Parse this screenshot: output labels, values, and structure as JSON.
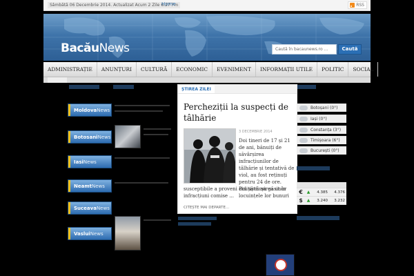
{
  "topbar": {
    "date": "Sâmbătă 06 Decembrie 2014. Actualizat Acum 2 Zile 6:27 Pm",
    "home": "Home",
    "rss": "RSS"
  },
  "header": {
    "logo_bold": "Bacău",
    "logo_light": "News",
    "search_placeholder": "Caută în bacaunews.ro ...",
    "search_button": "Caută"
  },
  "nav": {
    "items": [
      "ADMINISTRAȚIE",
      "ANUNȚURI",
      "CULTURĂ",
      "ECONOMIC",
      "EVENIMENT",
      "INFORMAȚII UTILE",
      "POLITIC",
      "SOCIAL"
    ]
  },
  "cities": [
    {
      "bold": "Moldova",
      "light": "News"
    },
    {
      "bold": "Botosani",
      "light": "News"
    },
    {
      "bold": "Iasi",
      "light": "News"
    },
    {
      "bold": "Neamt",
      "light": "News"
    },
    {
      "bold": "Suceava",
      "light": "News"
    },
    {
      "bold": "Vaslui",
      "light": "News"
    }
  ],
  "feature": {
    "label": "ȘTIREA ZILEI",
    "title": "Percheziții la suspecți de tâlhărie",
    "date": "3 DECEMBRIE 2014",
    "body_right": "Doi tineri de 17 și 21 de ani, bănuiți de săvârșirea infracțiunilor de tâlhărie și tentativă de viol, au fost reținuți pentru 24 de ore. Polițiștii au găsit în locuințele lor bunuri",
    "body_bottom": "susceptibile a proveni din săvârșirea unor infracțiuni comise ...",
    "more": "CITEȘTE MAI DEPARTE..."
  },
  "weather": [
    {
      "city": "Botoșani",
      "temp": "(0°)"
    },
    {
      "city": "Iași",
      "temp": "(0°)"
    },
    {
      "city": "Constanța",
      "temp": "(3°)"
    },
    {
      "city": "Timișoara",
      "temp": "(6°)"
    },
    {
      "city": "București",
      "temp": "(0°)"
    }
  ],
  "fx": [
    {
      "symbol": "€",
      "buy": "4.385",
      "sell": "4.376"
    },
    {
      "symbol": "$",
      "buy": "3.240",
      "sell": "3.232"
    }
  ],
  "colors": {
    "accent": "#2b6fb5",
    "header_top": "#6f9fca",
    "header_bottom": "#2d5f95"
  }
}
